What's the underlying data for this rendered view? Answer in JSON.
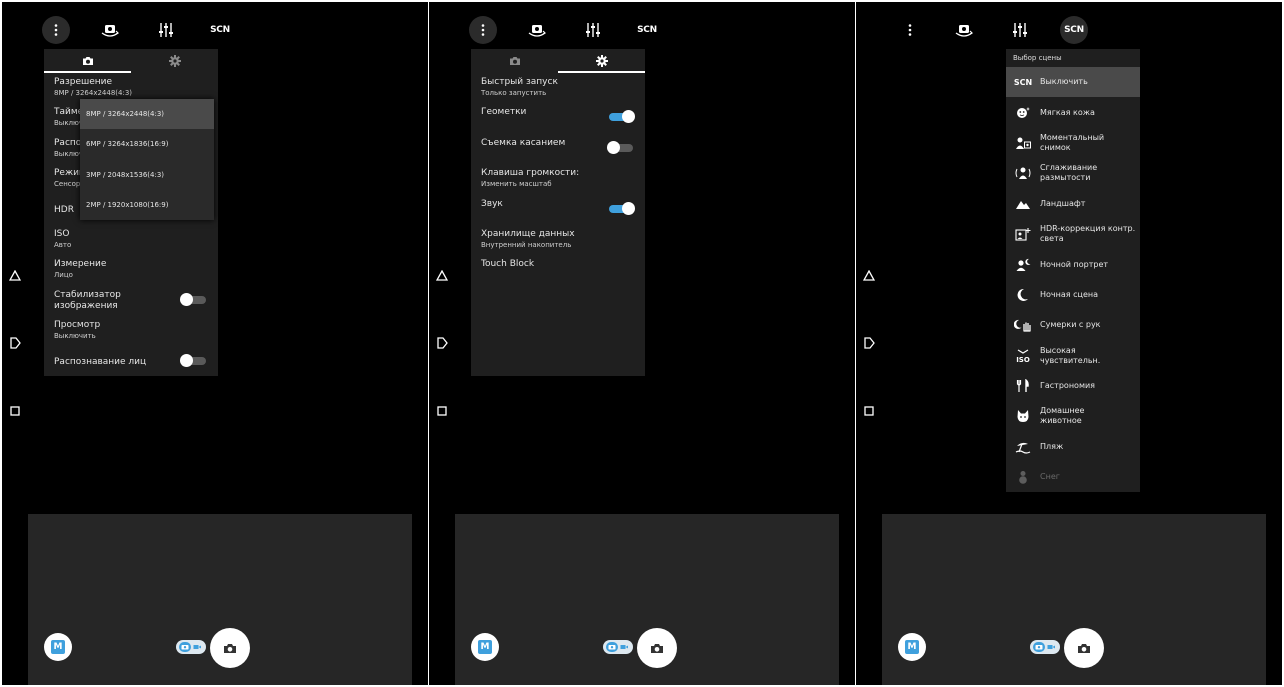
{
  "topbar": {
    "scn_label": "SCN"
  },
  "camera_settings": {
    "rows": [
      {
        "title": "Разрешение",
        "sub": "8MP / 3264x2448(4:3)"
      },
      {
        "title": "Таймер",
        "sub": "Выключить"
      },
      {
        "title": "Распознавание",
        "sub": "Выключить"
      },
      {
        "title": "Режим фокусировки",
        "sub": "Сенсорная фокусировка"
      },
      {
        "title": "HDR",
        "toggle": "off"
      },
      {
        "title": "ISO",
        "sub": "Авто"
      },
      {
        "title": "Измерение",
        "sub": "Лицо"
      },
      {
        "title": "Стабилизатор изображения",
        "toggle": "off"
      },
      {
        "title": "Просмотр",
        "sub": "Выключить"
      },
      {
        "title": "Распознавание лиц",
        "toggle": "off"
      }
    ],
    "resolution_options": [
      "8MP / 3264x2448(4:3)",
      "6MP / 3264x1836(16:9)",
      "3MP / 2048x1536(4:3)",
      "2MP / 1920x1080(16:9)"
    ],
    "selected_resolution_index": 0
  },
  "general_settings": {
    "rows": [
      {
        "title": "Быстрый запуск",
        "sub": "Только запустить"
      },
      {
        "title": "Геометки",
        "toggle": "on"
      },
      {
        "title": "Съемка касанием",
        "toggle": "off"
      },
      {
        "title": "Клавиша громкости:",
        "sub": "Изменить масштаб"
      },
      {
        "title": "Звук",
        "toggle": "on"
      },
      {
        "title": "Хранилище данных",
        "sub": "Внутренний накопитель"
      },
      {
        "title": "Touch Block"
      }
    ]
  },
  "scene_selection": {
    "header": "Выбор сцены",
    "items": [
      {
        "label": "Выключить",
        "icon": "scn-off-icon",
        "selected": true
      },
      {
        "label": "Мягкая кожа",
        "icon": "soft-skin-icon"
      },
      {
        "label": "Моментальный снимок",
        "icon": "instant-snapshot-icon"
      },
      {
        "label": "Сглаживание размытости",
        "icon": "anti-blur-icon"
      },
      {
        "label": "Ландшафт",
        "icon": "landscape-icon"
      },
      {
        "label": "HDR-коррекция контр. света",
        "icon": "backlight-hdr-icon"
      },
      {
        "label": "Ночной портрет",
        "icon": "night-portrait-icon"
      },
      {
        "label": "Ночная сцена",
        "icon": "night-scene-icon"
      },
      {
        "label": "Сумерки с рук",
        "icon": "handheld-twilight-icon"
      },
      {
        "label": "Высокая чувствительн.",
        "icon": "high-sensitivity-icon"
      },
      {
        "label": "Гастрономия",
        "icon": "gourmet-icon"
      },
      {
        "label": "Домашнее животное",
        "icon": "pet-icon"
      },
      {
        "label": "Пляж",
        "icon": "beach-icon"
      },
      {
        "label": "Снег",
        "icon": "snow-icon",
        "disabled": true
      }
    ]
  },
  "bottom": {
    "mode_label": "M"
  },
  "colors": {
    "accent": "#3fa0dd",
    "panel": "#1f1f1f",
    "selected": "#4a4a4a",
    "bottom_bar": "#262626"
  }
}
